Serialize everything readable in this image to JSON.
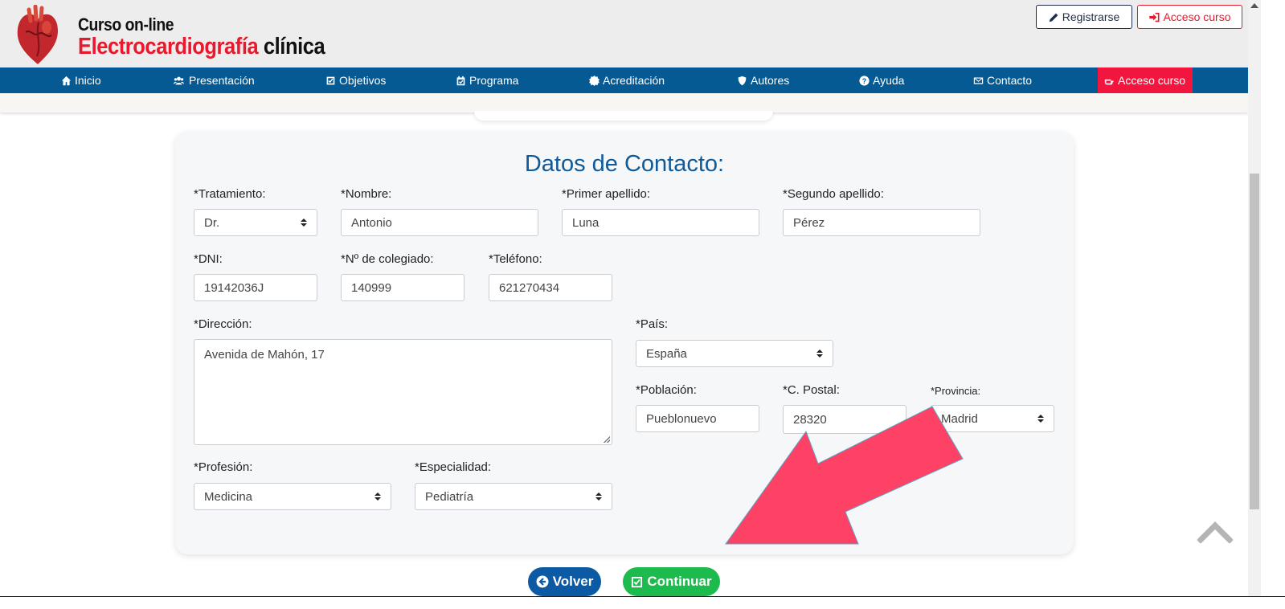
{
  "header": {
    "logo_line1": "Curso on-line",
    "logo_word_red": "Electrocardiografía",
    "logo_word_black": "clínica",
    "register_label": "Registrarse",
    "access_label": "Acceso curso"
  },
  "nav": {
    "items": [
      {
        "label": "Inicio",
        "icon": "home-icon"
      },
      {
        "label": "Presentación",
        "icon": "users-icon"
      },
      {
        "label": "Objetivos",
        "icon": "check-square-icon"
      },
      {
        "label": "Programa",
        "icon": "calendar-check-icon"
      },
      {
        "label": "Acreditación",
        "icon": "certificate-icon"
      },
      {
        "label": "Autores",
        "icon": "shield-icon"
      },
      {
        "label": "Ayuda",
        "icon": "question-circle-icon"
      },
      {
        "label": "Contacto",
        "icon": "envelope-icon"
      },
      {
        "label": "Acceso curso",
        "icon": "hand-pointer-icon"
      }
    ]
  },
  "form": {
    "title": "Datos de Contacto:",
    "tratamiento": {
      "label": "*Tratamiento:",
      "value": "Dr."
    },
    "nombre": {
      "label": "*Nombre:",
      "value": "Antonio"
    },
    "primer_apellido": {
      "label": "*Primer apellido:",
      "value": "Luna"
    },
    "segundo_apellido": {
      "label": "*Segundo apellido:",
      "value": "Pérez"
    },
    "dni": {
      "label": "*DNI:",
      "value": "19142036J"
    },
    "colegiado": {
      "label": "*Nº de colegiado:",
      "value": "140999"
    },
    "telefono": {
      "label": "*Teléfono:",
      "value": "621270434"
    },
    "direccion": {
      "label": "*Dirección:",
      "value": "Avenida de Mahón, 17"
    },
    "pais": {
      "label": "*País:",
      "value": "España"
    },
    "poblacion": {
      "label": "*Población:",
      "value": "Pueblonuevo"
    },
    "postal": {
      "label": "*C. Postal:",
      "value": "28320"
    },
    "provincia": {
      "label": "*Provincia:",
      "value": "Madrid"
    },
    "profesion": {
      "label": "*Profesión:",
      "value": "Medicina"
    },
    "especialidad": {
      "label": "*Especialidad:",
      "value": "Pediatría"
    }
  },
  "actions": {
    "back_label": "Volver",
    "continue_label": "Continuar"
  },
  "colors": {
    "nav_bg": "#055a94",
    "accent_red": "#f2163f",
    "title_blue": "#0f5a99",
    "back_blue": "#0b5aa3",
    "continue_green": "#1dbb4d",
    "annotation_arrow": "#fd4266"
  }
}
